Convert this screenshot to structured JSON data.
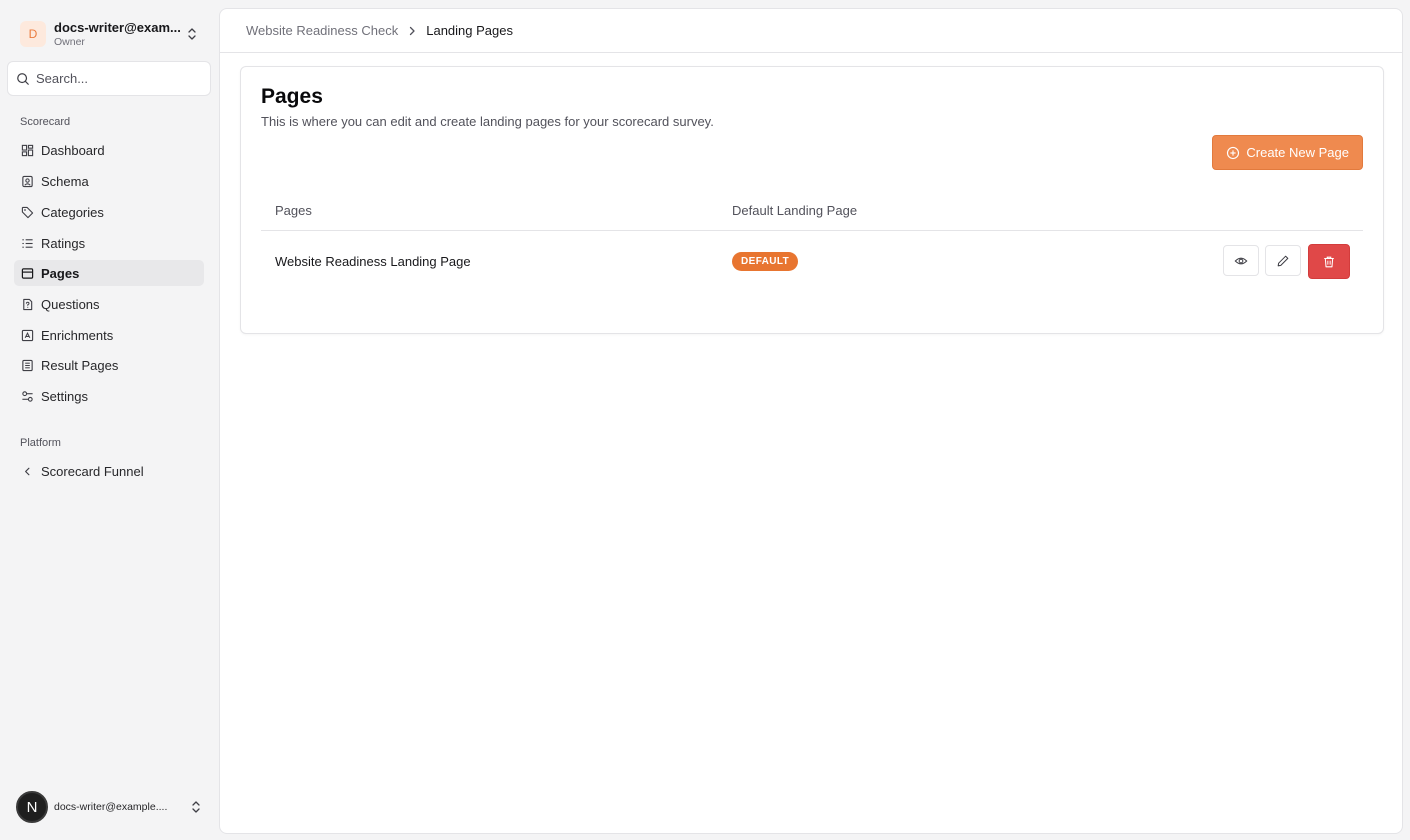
{
  "workspace": {
    "initial": "D",
    "name": "docs-writer@exam...",
    "role": "Owner"
  },
  "search": {
    "placeholder": "Search..."
  },
  "sidebar": {
    "group1_label": "Scorecard",
    "items": [
      {
        "label": "Dashboard",
        "icon": "dashboard-icon"
      },
      {
        "label": "Schema",
        "icon": "schema-icon"
      },
      {
        "label": "Categories",
        "icon": "tag-icon"
      },
      {
        "label": "Ratings",
        "icon": "list-icon"
      },
      {
        "label": "Pages",
        "icon": "pages-icon",
        "active": true
      },
      {
        "label": "Questions",
        "icon": "question-icon"
      },
      {
        "label": "Enrichments",
        "icon": "enrichment-icon"
      },
      {
        "label": "Result Pages",
        "icon": "result-pages-icon"
      },
      {
        "label": "Settings",
        "icon": "settings-icon"
      }
    ],
    "group2_label": "Platform",
    "platform_items": [
      {
        "label": "Scorecard Funnel",
        "icon": "chevron-left-icon"
      }
    ]
  },
  "user": {
    "initial": "N",
    "email": "docs-writer@example...."
  },
  "breadcrumb": {
    "parent": "Website Readiness Check",
    "current": "Landing Pages"
  },
  "card": {
    "title": "Pages",
    "description": "This is where you can edit and create landing pages for your scorecard survey.",
    "create_button": "Create New Page"
  },
  "table": {
    "columns": [
      "Pages",
      "Default Landing Page"
    ],
    "rows": [
      {
        "name": "Website Readiness Landing Page",
        "badge": "DEFAULT"
      }
    ]
  },
  "colors": {
    "accent": "#ef8a4f",
    "badge": "#e87530",
    "danger": "#e04848"
  }
}
